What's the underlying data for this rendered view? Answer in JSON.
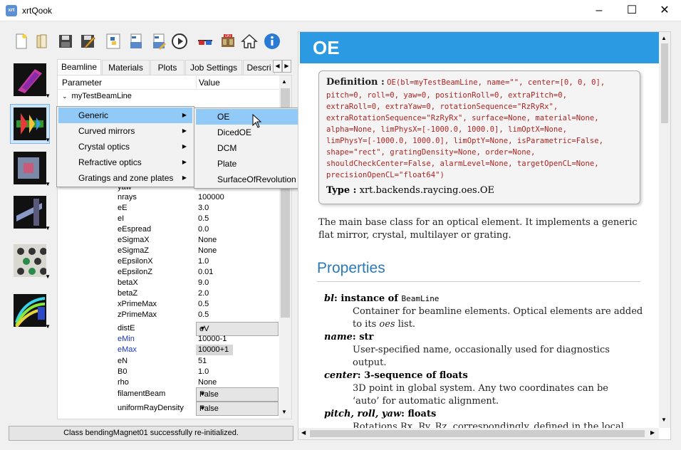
{
  "window": {
    "title": "xrtQook",
    "app_icon": "xrt",
    "minimize": "–",
    "maximize": "☐",
    "close": "✕"
  },
  "tabs": [
    {
      "label": "Beamline"
    },
    {
      "label": "Materials"
    },
    {
      "label": "Plots"
    },
    {
      "label": "Job Settings"
    },
    {
      "label": "Descri"
    }
  ],
  "tree": {
    "col_param": "Parameter",
    "col_value": "Value",
    "root": "myTestBeamLine",
    "rows": [
      {
        "param": "yaw",
        "value": ""
      },
      {
        "param": "nrays",
        "value": "100000"
      },
      {
        "param": "eE",
        "value": "3.0"
      },
      {
        "param": "eI",
        "value": "0.5"
      },
      {
        "param": "eEspread",
        "value": "0.0"
      },
      {
        "param": "eSigmaX",
        "value": "None"
      },
      {
        "param": "eSigmaZ",
        "value": "None"
      },
      {
        "param": "eEpsilonX",
        "value": "1.0"
      },
      {
        "param": "eEpsilonZ",
        "value": "0.01"
      },
      {
        "param": "betaX",
        "value": "9.0"
      },
      {
        "param": "betaZ",
        "value": "2.0"
      },
      {
        "param": "xPrimeMax",
        "value": "0.5"
      },
      {
        "param": "zPrimeMax",
        "value": "0.5"
      },
      {
        "param": "distE",
        "value": "eV"
      },
      {
        "param": "eMin",
        "value": "10000-1"
      },
      {
        "param": "eMax",
        "value": "10000+1"
      },
      {
        "param": "eN",
        "value": "51"
      },
      {
        "param": "B0",
        "value": "1.0"
      },
      {
        "param": "rho",
        "value": "None"
      },
      {
        "param": "filamentBeam",
        "value": "False"
      },
      {
        "param": "uniformRayDensity",
        "value": "False"
      }
    ]
  },
  "menu1": [
    "Generic",
    "Curved mirrors",
    "Crystal optics",
    "Refractive optics",
    "Gratings and zone plates"
  ],
  "menu2": [
    "OE",
    "DicedOE",
    "DCM",
    "Plate",
    "SurfaceOfRevolution"
  ],
  "status": "Class bendingMagnet01 successfully re-initialized.",
  "doc": {
    "title": "OE",
    "definition_label": "Definition :",
    "definition_lines": [
      "OE(bl=myTestBeamLine, name=\"\", center=[0, 0, 0],",
      "pitch=0, roll=0, yaw=0, positionRoll=0, extraPitch=0,",
      "extraRoll=0, extraYaw=0, rotationSequence=\"RzRyRx\",",
      "extraRotationSequence=\"RzRyRx\", surface=None, material=None,",
      "alpha=None, limPhysX=[-1000.0, 1000.0], limOptX=None,",
      "limPhysY=[-1000.0, 1000.0], limOptY=None, isParametric=False,",
      "shape=\"rect\", gratingDensity=None, order=None,",
      "shouldCheckCenter=False, alarmLevel=None, targetOpenCL=None,",
      "precisionOpenCL=\"float64\")"
    ],
    "type_label": "Type :",
    "type_value": "xrt.backends.raycing.oes.OE",
    "intro_1": "The main base class for an optical element. It implements a generic",
    "intro_2": "flat mirror, crystal, multilayer or grating.",
    "properties_heading": "Properties",
    "props": {
      "bl_name": "bl",
      "bl_type": ": instance of ",
      "bl_type_mono": "BeamLine",
      "bl_d1": "Container for beamline elements. Optical elements are added",
      "bl_d2a": "to its ",
      "bl_d2b": "oes",
      "bl_d2c": " list.",
      "name_name": "name",
      "name_type": ": str",
      "name_d1": "User-specified name, occasionally used for diagnostics",
      "name_d2": "output.",
      "center_name": "center",
      "center_type": ": 3-sequence of floats",
      "center_d1": "3D point in global system. Any two coordinates can be",
      "center_d2": "‘auto’ for automatic alignment.",
      "pry_name": "pitch, roll, yaw",
      "pry_type": ": floats",
      "pry_d1": "Rotations Rx, Ry, Rz, correspondingly, defined in the local"
    }
  }
}
